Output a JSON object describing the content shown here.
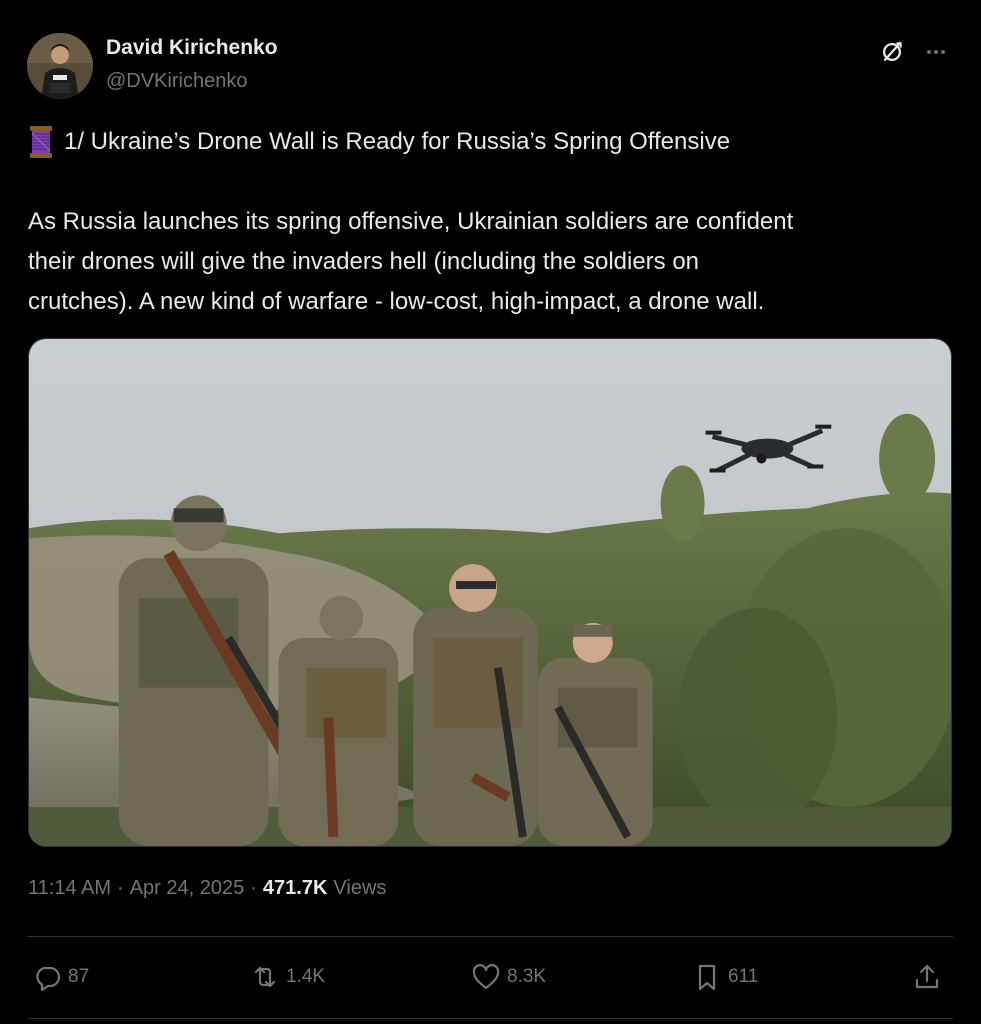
{
  "author": {
    "display_name": "David Kirichenko",
    "handle": "@DVKirichenko",
    "avatar_icon": "avatar-photo"
  },
  "tweet": {
    "title_emoji": "thread-emoji",
    "title": "1/ Ukraine’s Drone Wall is Ready for Russia’s Spring Offensive",
    "body_lines": [
      "As Russia launches its spring offensive, Ukrainian soldiers are confident",
      "their drones will give the invaders hell (including the soldiers on",
      "crutches). A new kind of warfare - low-cost, high-impact, a drone wall."
    ]
  },
  "media": {
    "icon": "photo-soldiers-with-drone"
  },
  "meta": {
    "time": "11:14 AM",
    "date": "Apr 24, 2025",
    "views_count": "471.7K",
    "views_label": "Views",
    "separator": "·"
  },
  "actions": {
    "replies": "87",
    "reposts": "1.4K",
    "likes": "8.3K",
    "bookmarks": "611"
  },
  "colors": {
    "background": "#000000",
    "text": "#e7e9ea",
    "muted": "#71767b",
    "border": "#2f3336"
  }
}
